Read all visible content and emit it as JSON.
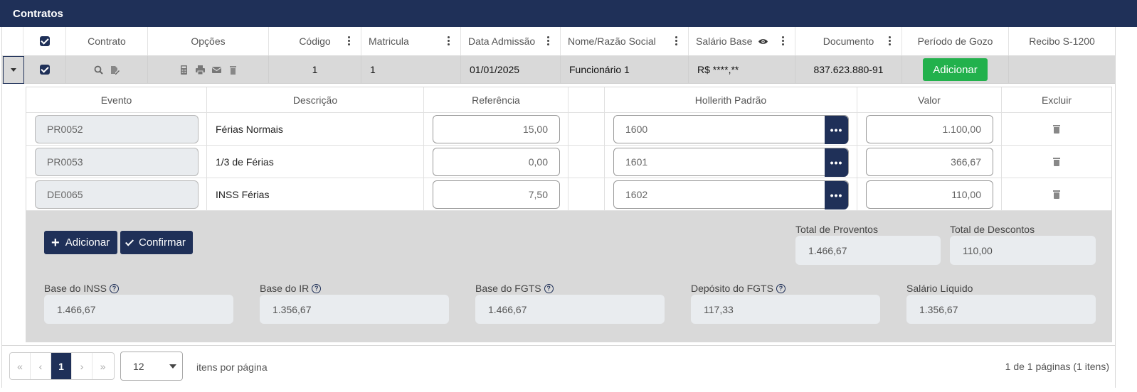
{
  "title": "Contratos",
  "columns": {
    "contrato": "Contrato",
    "opcoes": "Opções",
    "codigo": "Código",
    "matricula": "Matricula",
    "data_admissao": "Data Admissão",
    "nome": "Nome/Razão Social",
    "salario_base": "Salário Base",
    "documento": "Documento",
    "periodo_gozo": "Período de Gozo",
    "recibo": "Recibo S-1200"
  },
  "row": {
    "codigo": "1",
    "matricula": "1",
    "data_admissao": "01/01/2025",
    "nome": "Funcionário 1",
    "salario_base": "R$ ****,**",
    "documento": "837.623.880-91",
    "periodo_button": "Adicionar"
  },
  "events_header": {
    "evento": "Evento",
    "descricao": "Descrição",
    "referencia": "Referência",
    "hollerith": "Hollerith Padrão",
    "valor": "Valor",
    "excluir": "Excluir"
  },
  "events": [
    {
      "evento": "PR0052",
      "descricao": "Férias Normais",
      "referencia": "15,00",
      "hollerith": "1600",
      "valor": "1.100,00"
    },
    {
      "evento": "PR0053",
      "descricao": "1/3 de Férias",
      "referencia": "0,00",
      "hollerith": "1601",
      "valor": "366,67"
    },
    {
      "evento": "DE0065",
      "descricao": "INSS Férias",
      "referencia": "7,50",
      "hollerith": "1602",
      "valor": "110,00"
    }
  ],
  "actions": {
    "adicionar": "Adicionar",
    "confirmar": "Confirmar"
  },
  "totals": {
    "proventos_label": "Total de Proventos",
    "proventos_value": "1.466,67",
    "descontos_label": "Total de Descontos",
    "descontos_value": "110,00"
  },
  "bases": [
    {
      "label": "Base do INSS",
      "value": "1.466,67",
      "help": true
    },
    {
      "label": "Base do IR",
      "value": "1.356,67",
      "help": true
    },
    {
      "label": "Base do FGTS",
      "value": "1.466,67",
      "help": true
    },
    {
      "label": "Depósito do FGTS",
      "value": "117,33",
      "help": true
    },
    {
      "label": "Salário Líquido",
      "value": "1.356,67",
      "help": false
    }
  ],
  "pagination": {
    "first": "«",
    "prev": "‹",
    "current": "1",
    "next": "›",
    "last": "»",
    "page_size": "12",
    "items_label": "itens por página",
    "summary": "1 de 1 páginas (1 itens)"
  }
}
